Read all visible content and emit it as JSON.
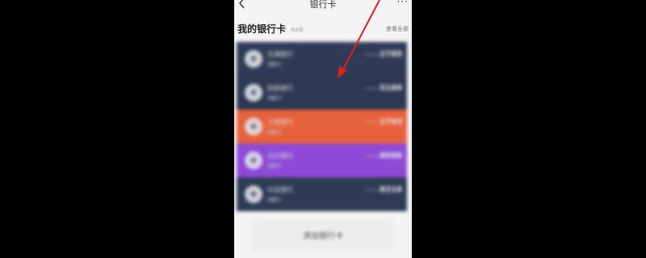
{
  "colors": {
    "card_navy": "#2f3b55",
    "card_orange": "#e6623d",
    "card_purple": "#8e4ad6",
    "arrow": "#d9221a"
  },
  "header": {
    "title": "银行卡",
    "back_icon": "chevron-left-icon",
    "more_icon": "more-dots-icon",
    "more_label": "···"
  },
  "section": {
    "title": "我的银行卡",
    "count": "共6张",
    "view_all": "查看全部"
  },
  "cards": [
    {
      "bank": "交通银行",
      "type": "储蓄卡",
      "masked": "****",
      "last4": "2785",
      "color": "#2f3b55"
    },
    {
      "bank": "招商银行",
      "type": "储蓄卡",
      "masked": "****",
      "last4": "5189",
      "color": "#2d3852"
    },
    {
      "bank": "工商银行",
      "type": "储蓄卡",
      "masked": "****",
      "last4": "1793",
      "color": "#e6623d"
    },
    {
      "bank": "光大银行",
      "type": "储蓄卡",
      "masked": "****",
      "last4": "8096",
      "color": "#8e4ad6"
    },
    {
      "bank": "兴业银行",
      "type": "储蓄卡",
      "masked": "****",
      "last4": "8216",
      "color": "#2f3b55"
    }
  ],
  "add_button": {
    "label": "添加银行卡"
  }
}
